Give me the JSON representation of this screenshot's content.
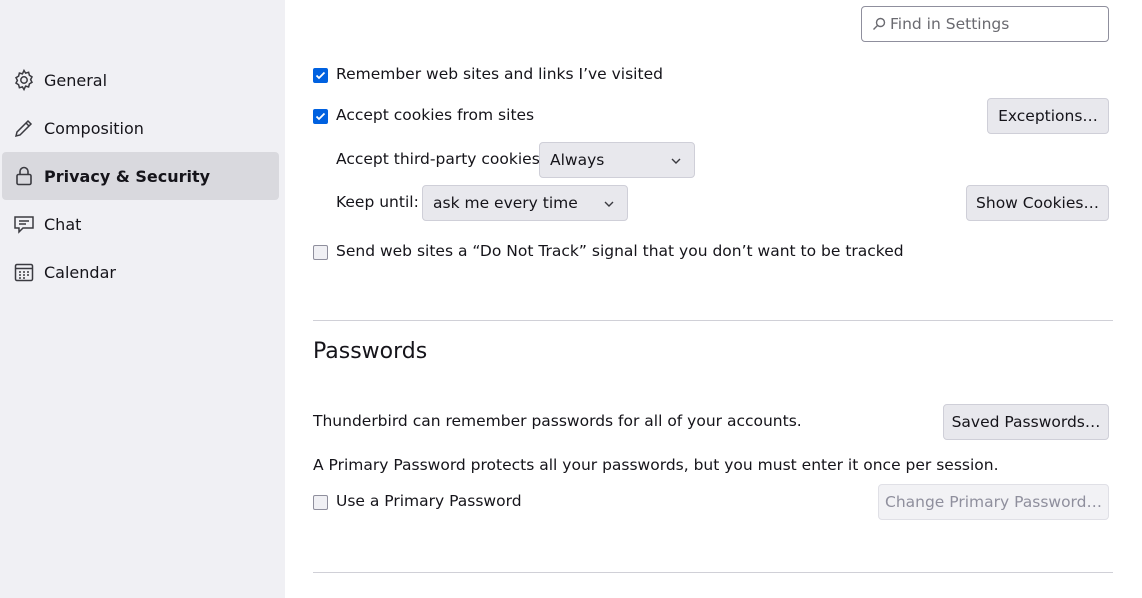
{
  "sidebar": {
    "items": [
      {
        "label": "General",
        "icon": "gear-icon",
        "selected": false
      },
      {
        "label": "Composition",
        "icon": "pencil-icon",
        "selected": false
      },
      {
        "label": "Privacy & Security",
        "icon": "lock-icon",
        "selected": true
      },
      {
        "label": "Chat",
        "icon": "chat-bubble-icon",
        "selected": false
      },
      {
        "label": "Calendar",
        "icon": "calendar-icon",
        "selected": false
      }
    ]
  },
  "search": {
    "placeholder": "Find in Settings"
  },
  "cookies": {
    "remember_sites_label": "Remember web sites and links I’ve visited",
    "remember_sites_checked": true,
    "accept_cookies_label": "Accept cookies from sites",
    "accept_cookies_checked": true,
    "exceptions_button": "Exceptions…",
    "third_party_label": "Accept third-party cookies:",
    "third_party_value": "Always",
    "keep_until_label": "Keep until:",
    "keep_until_value": "ask me every time",
    "show_cookies_button": "Show Cookies…",
    "dnt_label": "Send web sites a “Do Not Track” signal that you don’t want to be tracked",
    "dnt_checked": false
  },
  "passwords": {
    "heading": "Passwords",
    "remember_text": "Thunderbird can remember passwords for all of your accounts.",
    "saved_passwords_button": "Saved Passwords…",
    "primary_info": "A Primary Password protects all your passwords, but you must enter it once per session.",
    "use_primary_label": "Use a Primary Password",
    "use_primary_checked": false,
    "change_primary_button": "Change Primary Password…"
  },
  "colors": {
    "accent": "#0061e0",
    "sidebar_bg": "#f0f0f4",
    "selected_bg": "#d9d9de"
  }
}
